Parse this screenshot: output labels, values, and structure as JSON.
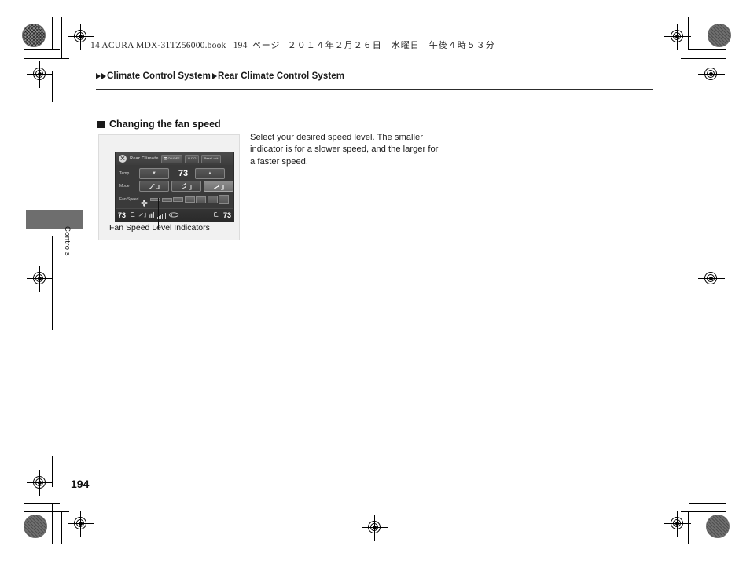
{
  "page": {
    "header_line": "14 ACURA MDX-31TZ56000.book",
    "header_page": "194",
    "header_page_unit": "ページ",
    "header_date": "２０１４年２月２６日　水曜日　午後４時５３分",
    "page_number": "194"
  },
  "breadcrumb": {
    "level1": "Climate Control System",
    "level2": "Rear Climate Control System"
  },
  "section": {
    "heading": "Changing the fan speed",
    "body": "Select your desired speed level. The smaller indicator is for a slower speed, and the larger for a faster speed."
  },
  "figure": {
    "caption": "Fan Speed Level Indicators",
    "screen": {
      "title": "Rear Climate",
      "close_icon": "close-icon",
      "buttons": [
        {
          "label": "ON/OFF",
          "icon": "x-icon"
        },
        {
          "label": "AUTO",
          "icon": ""
        },
        {
          "label": "Rear Lock",
          "icon": ""
        }
      ],
      "rows": [
        {
          "label": "Temp",
          "down_arrow": "▼",
          "value": "73",
          "up_arrow": "▲"
        },
        {
          "label": "Mode",
          "modes": [
            "face-vent-icon",
            "face-and-floor-vent-icon",
            "floor-vent-icon"
          ],
          "selected_index": 2
        },
        {
          "label": "Fan Speed",
          "fan_icon": "fan-icon",
          "segments": 7,
          "selected_index": 0
        }
      ],
      "status_bar": {
        "left_temp": "73",
        "right_temp": "73",
        "left_icons": [
          "seat-heater-icon",
          "airflow-icon"
        ],
        "center_icons": [
          "fan-level-icon",
          "signal-bars-icon",
          "recirculate-icon"
        ],
        "right_icons": [
          "seat-heater-icon"
        ]
      }
    }
  },
  "sidebar": {
    "tab_label": "Controls"
  },
  "colors": {
    "screen_bg": "#3a3a3a",
    "rule": "#2c2c2c",
    "tab": "#6e6e6e",
    "figure_bg": "#f1f1f1"
  }
}
